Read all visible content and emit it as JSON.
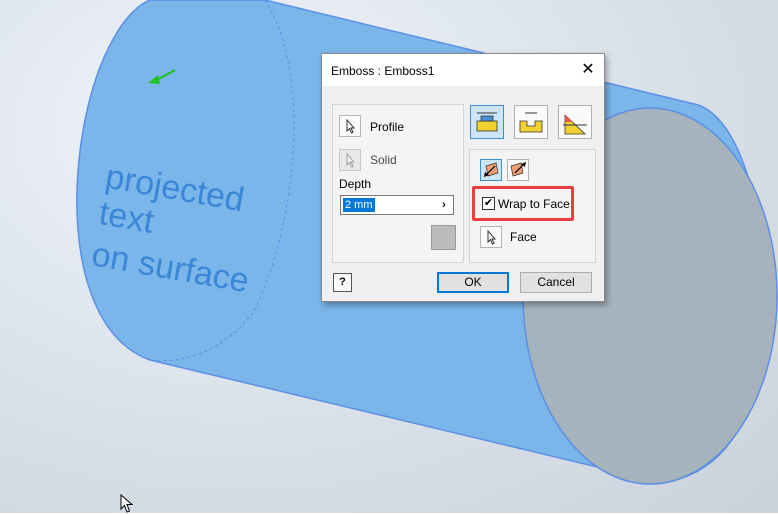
{
  "viewport": {
    "surface_text": [
      "projected",
      "text",
      "on surface"
    ]
  },
  "dialog": {
    "title": "Emboss : Emboss1",
    "close_label": "✕",
    "profile_label": "Profile",
    "solid_label": "Solid",
    "depth_label": "Depth",
    "depth_value": "2 mm",
    "depth_arrow": "›",
    "wrap_checked": true,
    "wrap_label": "Wrap to Face",
    "face_label": "Face",
    "help_label": "?",
    "ok_label": "OK",
    "cancel_label": "Cancel"
  },
  "colors": {
    "cylinder": "#7ab6ea",
    "cylinder_edge": "#5c8fe6",
    "cap": "#a6b3bd",
    "text": "#3a87d8",
    "highlight": "#e84040"
  }
}
